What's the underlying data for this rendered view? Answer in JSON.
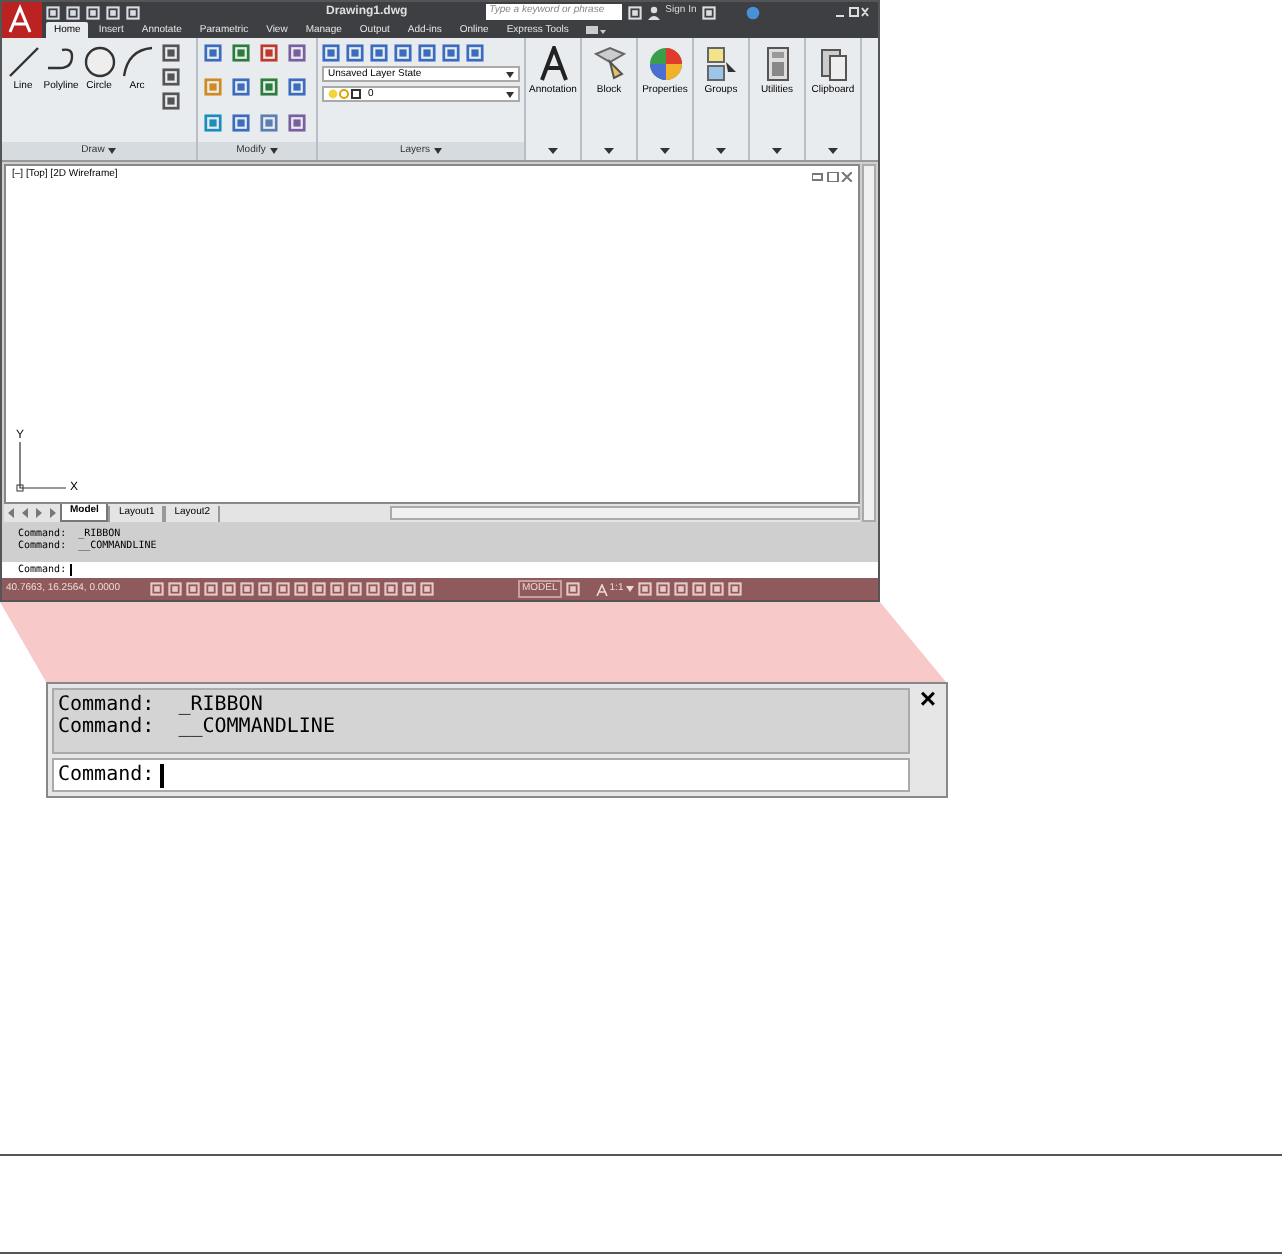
{
  "window": {
    "title": "Drawing1.dwg"
  },
  "search": {
    "placeholder": "Type a keyword or phrase"
  },
  "sign_in": "Sign In",
  "tabs": [
    {
      "label": "Home",
      "selected": true
    },
    {
      "label": "Insert",
      "selected": false
    },
    {
      "label": "Annotate",
      "selected": false
    },
    {
      "label": "Parametric",
      "selected": false
    },
    {
      "label": "View",
      "selected": false
    },
    {
      "label": "Manage",
      "selected": false
    },
    {
      "label": "Output",
      "selected": false
    },
    {
      "label": "Add-ins",
      "selected": false
    },
    {
      "label": "Online",
      "selected": false
    },
    {
      "label": "Express Tools",
      "selected": false
    }
  ],
  "draw_tools": [
    "Line",
    "Polyline",
    "Circle",
    "Arc"
  ],
  "panels": [
    "Draw",
    "Modify",
    "Layers"
  ],
  "layer_state": "Unsaved Layer State",
  "layer": "0",
  "big_buttons": [
    "Annotation",
    "Block",
    "Properties",
    "Groups",
    "Utilities",
    "Clipboard"
  ],
  "viewport": {
    "label": "[–] [Top] [2D Wireframe]",
    "axis_y": "Y",
    "axis_x": "X"
  },
  "layout_tabs": [
    {
      "label": "Model",
      "selected": true
    },
    {
      "label": "Layout1",
      "selected": false
    },
    {
      "label": "Layout2",
      "selected": false
    }
  ],
  "command_history": [
    "Command:  _RIBBON",
    "Command:  __COMMANDLINE"
  ],
  "command_prompt": "Command:",
  "status_bar": {
    "coordinates": "40.7663, 16.2564, 0.0000",
    "space": "MODEL",
    "scale": "1:1"
  },
  "callout": {
    "history": [
      "Command:  _RIBBON",
      "Command:  __COMMANDLINE"
    ],
    "prompt": "Command:",
    "close": "×"
  }
}
